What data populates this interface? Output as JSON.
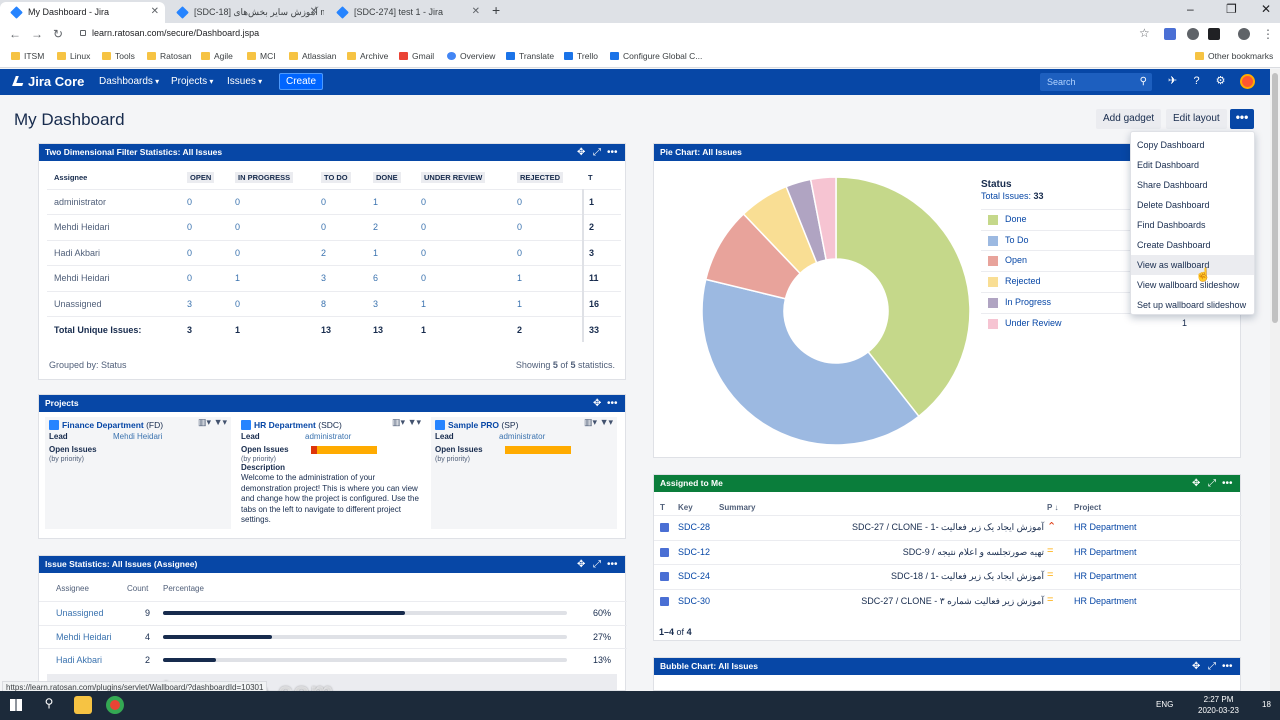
{
  "browser": {
    "tabs": [
      {
        "title": "My Dashboard - Jira",
        "active": true
      },
      {
        "title": "[SDC-18] آموزش سایر بخش‌های m",
        "active": false
      },
      {
        "title": "[SDC-274] test 1 - Jira",
        "active": false
      }
    ],
    "url": "learn.ratosan.com/secure/Dashboard.jspa",
    "bookmarks": [
      "ITSM",
      "Linux",
      "Tools",
      "Ratosan",
      "Agile",
      "MCI",
      "Atlassian",
      "Archive",
      "Gmail",
      "Overview",
      "Translate",
      "Trello",
      "Configure Global C..."
    ],
    "other_bookmarks": "Other bookmarks"
  },
  "jira": {
    "logo": "Jira Core",
    "nav": [
      "Dashboards",
      "Projects",
      "Issues"
    ],
    "create": "Create",
    "search_placeholder": "Search"
  },
  "dashboard": {
    "title": "My Dashboard",
    "add_gadget": "Add gadget",
    "edit_layout": "Edit layout",
    "more": "•••"
  },
  "menu": {
    "items": [
      "Copy Dashboard",
      "Edit Dashboard",
      "Share Dashboard",
      "Delete Dashboard",
      "Find Dashboards",
      "Create Dashboard",
      "View as wallboard",
      "View wallboard slideshow",
      "Set up wallboard slideshow"
    ],
    "hovered_index": 6
  },
  "two_dim": {
    "title": "Two Dimensional Filter Statistics: All Issues",
    "columns": [
      "Assignee",
      "OPEN",
      "IN PROGRESS",
      "TO DO",
      "DONE",
      "UNDER REVIEW",
      "REJECTED",
      "T"
    ],
    "rows": [
      {
        "name": "administrator",
        "vals": [
          "0",
          "0",
          "0",
          "1",
          "0",
          "0"
        ],
        "total": "1"
      },
      {
        "name": "Mehdi Heidari",
        "vals": [
          "0",
          "0",
          "0",
          "2",
          "0",
          "0"
        ],
        "total": "2"
      },
      {
        "name": "Hadi Akbari",
        "vals": [
          "0",
          "0",
          "2",
          "1",
          "0",
          "0"
        ],
        "total": "3"
      },
      {
        "name": "Mehdi Heidari",
        "vals": [
          "0",
          "1",
          "3",
          "6",
          "0",
          "1"
        ],
        "total": "11"
      },
      {
        "name": "Unassigned",
        "vals": [
          "3",
          "0",
          "8",
          "3",
          "1",
          "1"
        ],
        "total": "16"
      }
    ],
    "total_row": {
      "name": "Total Unique Issues:",
      "vals": [
        "3",
        "1",
        "13",
        "13",
        "1",
        "2"
      ],
      "total": "33"
    },
    "grouped_by": "Grouped by: Status",
    "showing": "Showing",
    "showing_n": "5",
    "showing_of": "of",
    "showing_total": "5",
    "showing_suffix": "statistics."
  },
  "projects": {
    "title": "Projects",
    "cards": [
      {
        "name": "Finance Department",
        "key": "(FD)",
        "lead_label": "Lead",
        "lead": "Mehdi Heidari",
        "open_label": "Open Issues",
        "priority": "(by priority)",
        "desc_label": "",
        "desc": ""
      },
      {
        "name": "HR Department",
        "key": "(SDC)",
        "lead_label": "Lead",
        "lead": "administrator",
        "open_label": "Open Issues",
        "priority": "(by priority)",
        "desc_label": "Description",
        "desc": "Welcome to the administration of your demonstration project! This is where you can view and change how the project is configured. Use the tabs on the left to navigate to different project settings."
      },
      {
        "name": "Sample PRO",
        "key": "(SP)",
        "lead_label": "Lead",
        "lead": "administrator",
        "open_label": "Open Issues",
        "priority": "(by priority)",
        "desc_label": "",
        "desc": ""
      }
    ]
  },
  "issue_stats": {
    "title": "Issue Statistics: All Issues (Assignee)",
    "headers": [
      "Assignee",
      "Count",
      "Percentage"
    ],
    "rows": [
      {
        "name": "Unassigned",
        "count": "9",
        "pct": "60%",
        "fraction": 0.6
      },
      {
        "name": "Mehdi Heidari",
        "count": "4",
        "pct": "27%",
        "fraction": 0.27
      },
      {
        "name": "Hadi Akbari",
        "count": "2",
        "pct": "13%",
        "fraction": 0.13
      }
    ]
  },
  "pie": {
    "title": "Pie Chart: All Issues",
    "legend_title": "Status",
    "total_label": "Total Issues:",
    "total": "33"
  },
  "chart_data": {
    "type": "pie",
    "title": "Pie Chart: All Issues",
    "categories": [
      "Done",
      "To Do",
      "Open",
      "Rejected",
      "In Progress",
      "Under Review"
    ],
    "values": [
      13,
      13,
      3,
      2,
      1,
      1
    ],
    "colors": [
      "#c5d88a",
      "#9cb9e1",
      "#e8a39b",
      "#f9de94",
      "#b0a4c2",
      "#f6c4d2"
    ],
    "legend": "right",
    "donut": true
  },
  "assigned": {
    "title": "Assigned to Me",
    "headers": [
      "T",
      "Key",
      "Summary",
      "P",
      "Project"
    ],
    "rows": [
      {
        "key": "SDC-28",
        "summary": "آموزش ایجاد یک زیر فعالیت -1 - SDC-27 / CLONE",
        "priority": "high",
        "project": "HR Department"
      },
      {
        "key": "SDC-12",
        "summary": "تهیه صورتجلسه و اعلام نتیجه / SDC-9",
        "priority": "medium",
        "project": "HR Department"
      },
      {
        "key": "SDC-24",
        "summary": "آموزش ایجاد یک زیر فعالیت -1 / SDC-18",
        "priority": "medium",
        "project": "HR Department"
      },
      {
        "key": "SDC-30",
        "summary": "آموزش زیر فعالیت شماره ۳ - SDC-27 / CLONE",
        "priority": "medium",
        "project": "HR Department"
      }
    ],
    "count_range": "1–4",
    "count_of": "of",
    "count_total": "4"
  },
  "bubble": {
    "title": "Bubble Chart: All Issues"
  },
  "status_url": "https://learn.ratosan.com/plugins/servlet/Wallboard/?dashboardId=10301",
  "watermark": "aparat.com/ratosan.com",
  "taskbar": {
    "lang": "ENG",
    "time": "2:27 PM",
    "date": "2020-03-23",
    "notif": "18"
  }
}
